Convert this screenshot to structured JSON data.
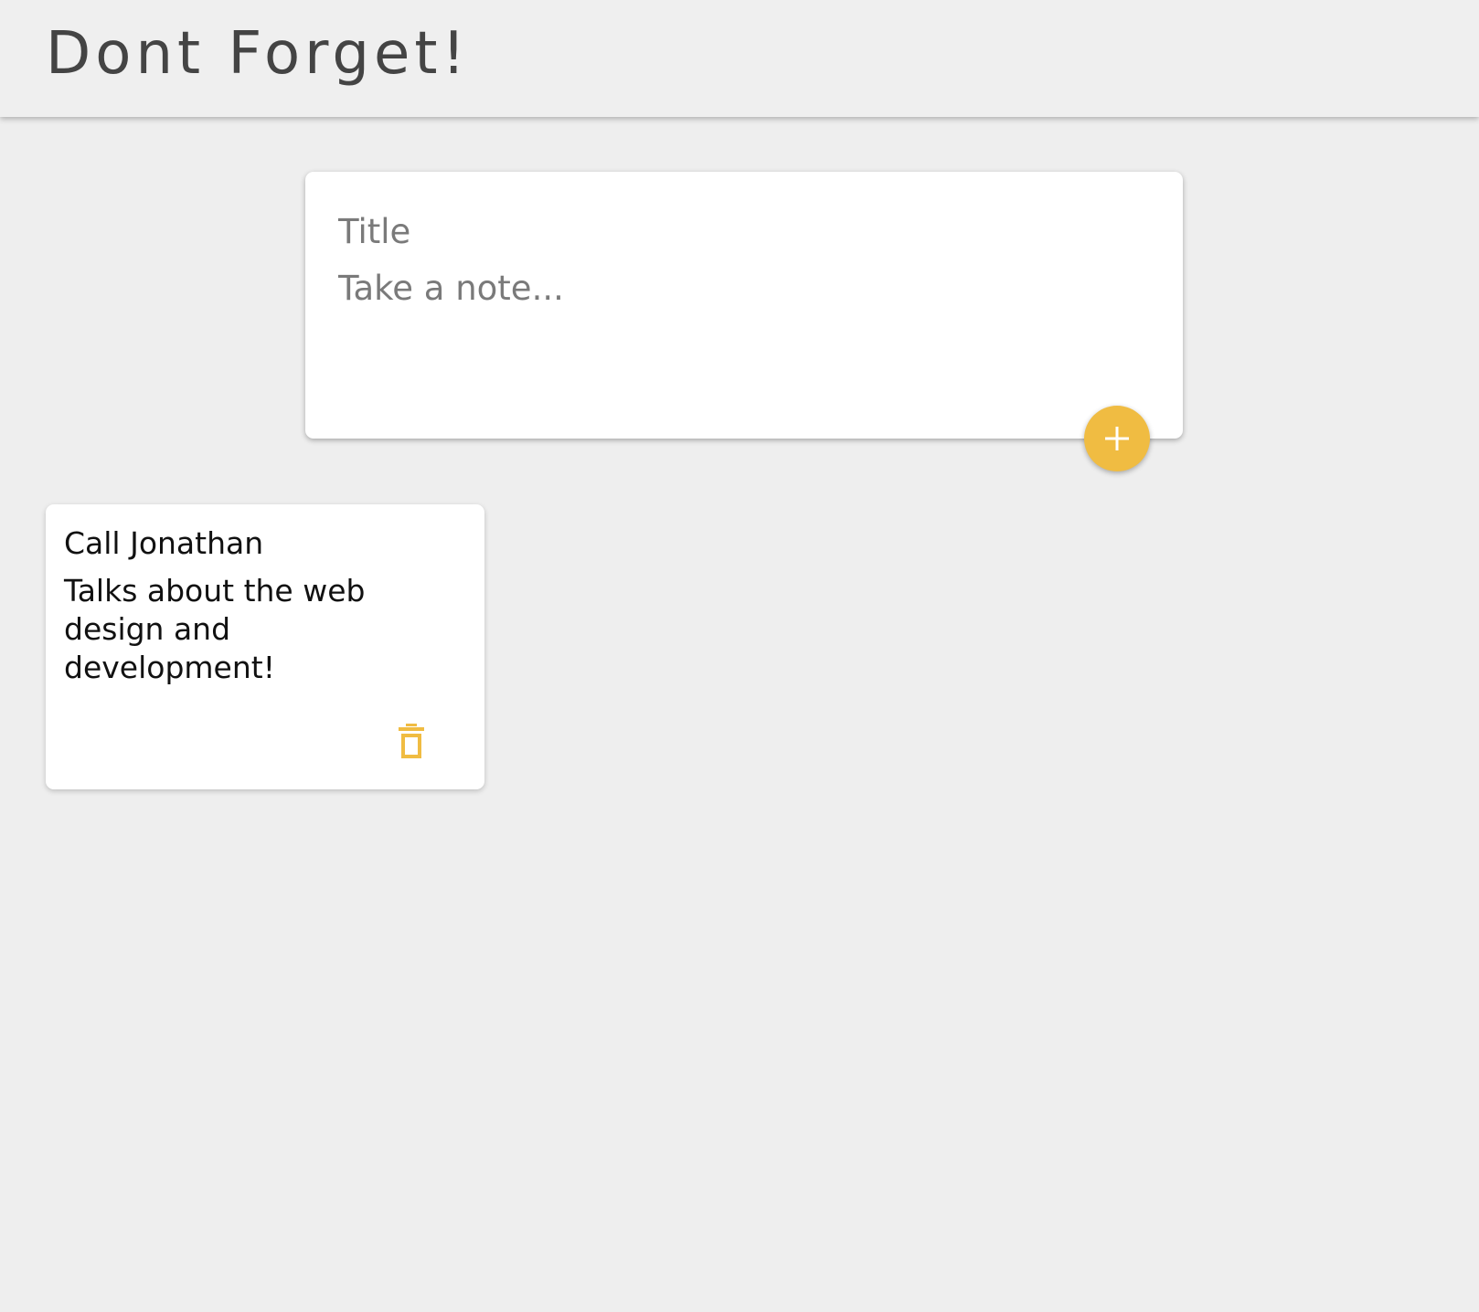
{
  "header": {
    "app_title": "Dont Forget!"
  },
  "composer": {
    "title_value": "",
    "title_placeholder": "Title",
    "content_value": "",
    "content_placeholder": "Take a note...",
    "add_icon": "plus-icon"
  },
  "notes": [
    {
      "title": "Call Jonathan",
      "content": "Talks about the web design and development!",
      "delete_icon": "trash-icon"
    }
  ],
  "colors": {
    "background": "#eeeeee",
    "header_background": "#efefef",
    "accent": "#f0bc42",
    "card_background": "#ffffff",
    "title_text": "#444444"
  }
}
